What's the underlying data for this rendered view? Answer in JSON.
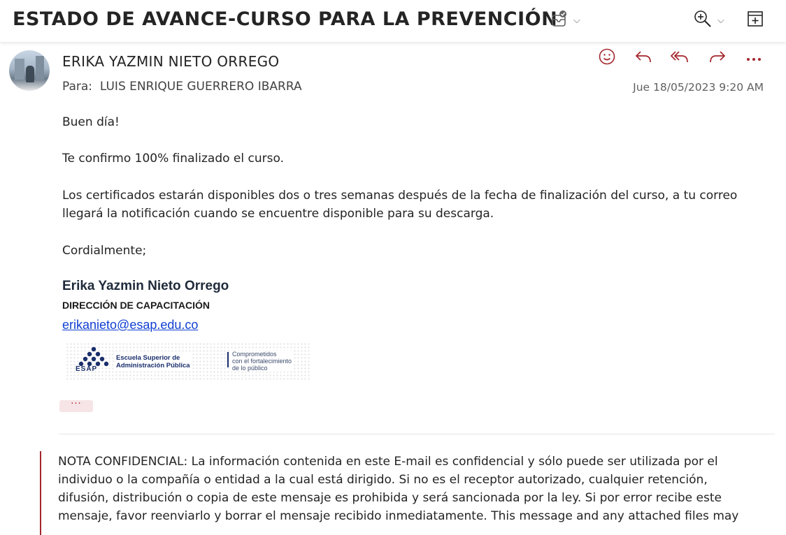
{
  "header": {
    "subject": "ESTADO DE AVANCE-CURSO PARA LA PREVENCIÓN",
    "icons": [
      "mail-check-icon",
      "zoom-in-icon",
      "open-new-window-icon"
    ]
  },
  "message": {
    "sender": "ERIKA YAZMIN NIETO ORREGO",
    "to_label": "Para:",
    "to": "LUIS ENRIQUE GUERRERO IBARRA",
    "date": "Jue 18/05/2023 9:20 AM",
    "actions": [
      "emoji-icon",
      "reply-icon",
      "reply-all-icon",
      "forward-icon",
      "more-icon"
    ],
    "accent_color": "#a4262c"
  },
  "body": {
    "greeting": "Buen día!",
    "line1": "Te confirmo 100% finalizado el curso.",
    "para_line1": "Los certificados estarán disponibles dos o tres semanas después de la fecha de finalización del curso, a tu correo",
    "para_line2": "llegará la notificación cuando se encuentre disponible para su descarga.",
    "closing": "Cordialmente;"
  },
  "signature": {
    "name": "Erika Yazmin Nieto Orrego",
    "department": "DIRECCIÓN DE CAPACITACIÓN",
    "email": "erikanieto@esap.edu.co",
    "logo_line1": "Escuela Superior de",
    "logo_line2": "Administración Pública",
    "logo_acronym": "ESAP",
    "slogan_line1": "Comprometidos",
    "slogan_line2": "con el fortalecimiento",
    "slogan_line3": "de lo público"
  },
  "show_more_label": "···",
  "confidential": {
    "line1": "NOTA CONFIDENCIAL: La información contenida en este E-mail es confidencial y sólo puede ser utilizada por el",
    "line2": "individuo o la compañía o entidad a la cual está dirigido. Si no es el receptor autorizado, cualquier retención,",
    "line3": "difusión, distribución o copia de este mensaje es prohibida y será sancionada por la ley. Si por error recibe este",
    "line4": "mensaje, favor reenviarlo y borrar el mensaje recibido inmediatamente. This message and any attached files may"
  }
}
